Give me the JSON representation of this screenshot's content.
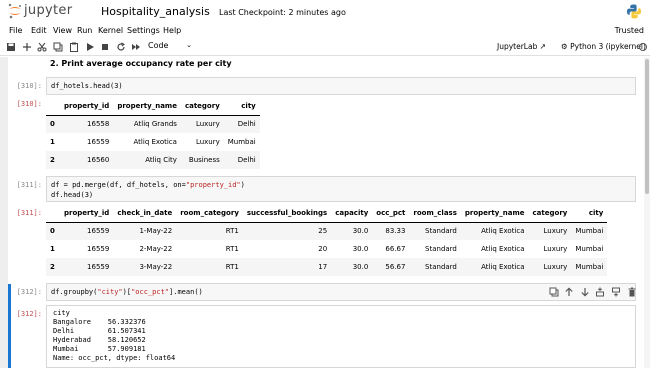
{
  "header": {
    "logo_text": "jupyter",
    "notebook_name": "Hospitality_analysis",
    "checkpoint": "Last Checkpoint: 2 minutes ago"
  },
  "menu": {
    "items": [
      "File",
      "Edit",
      "View",
      "Run",
      "Kernel",
      "Settings",
      "Help"
    ],
    "trusted": "Trusted"
  },
  "toolbar": {
    "cell_type": "Code",
    "jupyterlab": "JupyterLab",
    "kernel": "Python 3 (ipykernel)"
  },
  "cells": {
    "heading": "2. Print average occupancy rate per city",
    "c310_in_prompt": "[310]:",
    "c310_code": "df_hotels.head(3)",
    "c310_out_prompt": "[310]:",
    "t1": {
      "columns": [
        "property_id",
        "property_name",
        "category",
        "city"
      ],
      "rows": [
        {
          "idx": "0",
          "cells": [
            "16558",
            "Atliq Grands",
            "Luxury",
            "Delhi"
          ]
        },
        {
          "idx": "1",
          "cells": [
            "16559",
            "Atliq Exotica",
            "Luxury",
            "Mumbai"
          ]
        },
        {
          "idx": "2",
          "cells": [
            "16560",
            "Atliq City",
            "Business",
            "Delhi"
          ]
        }
      ]
    },
    "c311_in_prompt": "[311]:",
    "c311_code_l1_a": "df = pd.merge(df, df_hotels, on=",
    "c311_code_l1_b": "\"property_id\"",
    "c311_code_l1_c": ")",
    "c311_code_l2": "df.head(3)",
    "c311_out_prompt": "[311]:",
    "t2": {
      "columns": [
        "property_id",
        "check_in_date",
        "room_category",
        "successful_bookings",
        "capacity",
        "occ_pct",
        "room_class",
        "property_name",
        "category",
        "city"
      ],
      "rows": [
        {
          "idx": "0",
          "cells": [
            "16559",
            "1-May-22",
            "RT1",
            "25",
            "30.0",
            "83.33",
            "Standard",
            "Atliq Exotica",
            "Luxury",
            "Mumbai"
          ]
        },
        {
          "idx": "1",
          "cells": [
            "16559",
            "2-May-22",
            "RT1",
            "20",
            "30.0",
            "66.67",
            "Standard",
            "Atliq Exotica",
            "Luxury",
            "Mumbai"
          ]
        },
        {
          "idx": "2",
          "cells": [
            "16559",
            "3-May-22",
            "RT1",
            "17",
            "30.0",
            "56.67",
            "Standard",
            "Atliq Exotica",
            "Luxury",
            "Mumbai"
          ]
        }
      ]
    },
    "c312_in_prompt": "[312]:",
    "c312_code_a": "df.groupby(",
    "c312_code_b": "\"city\"",
    "c312_code_c": ")[",
    "c312_code_d": "\"occ_pct\"",
    "c312_code_e": "].mean()",
    "c312_out_prompt": "[312]:",
    "c312_output": "city\nBangalore    56.332376\nDelhi        61.507341\nHyderabad    58.120652\nMumbai       57.909181\nName: occ_pct, dtype: float64"
  },
  "colors": {
    "active_cell": "#1976d2",
    "jupyter_orange": "#f37726",
    "out_prompt": "#c05050"
  }
}
